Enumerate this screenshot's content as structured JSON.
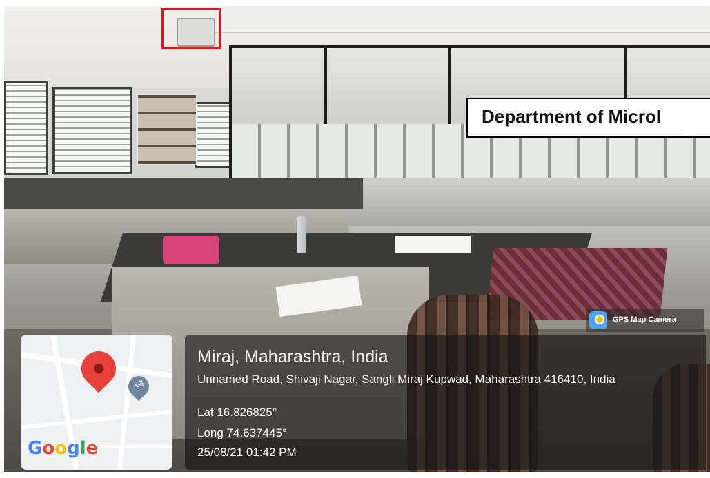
{
  "banner": {
    "text": "Department of Microl"
  },
  "gps_camera": {
    "label": "GPS Map Camera",
    "icon": "gps-map-camera-icon"
  },
  "map": {
    "logo": "Google",
    "marker_icon": "map-pin-icon",
    "poi_icon": "om-temple-icon",
    "poi_glyph": "ॐ"
  },
  "location": {
    "place": "Miraj, Maharashtra, India",
    "address": "Unnamed Road, Shivaji Nagar, Sangli Miraj Kupwad, Maharashtra 416410, India",
    "latitude": "Lat 16.826825°",
    "longitude": "Long 74.637445°",
    "timestamp": "25/08/21 01:42 PM"
  },
  "colors": {
    "highlight_box": "#e1141c",
    "pin": "#e6413a",
    "google_blue": "#4285F4",
    "google_red": "#EA4335",
    "google_yellow": "#FBBC05",
    "google_green": "#34A853"
  }
}
